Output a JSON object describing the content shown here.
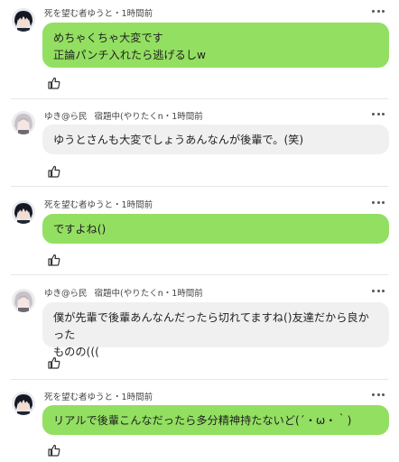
{
  "colors": {
    "own_bubble": "#93df62",
    "other_bubble": "#f0f0f0",
    "divider": "#e6e6e6"
  },
  "posts": [
    {
      "author": "死を望む者ゆうと",
      "status": "",
      "time": "1時間前",
      "text": "めちゃくちゃ大変です\n正論パンチ入れたら逃げるしw",
      "avatar_icon": "dark-hair-avatar-icon",
      "like_icon": "thumbs-up-icon",
      "more_icon": "more-options-icon"
    },
    {
      "author": "ゆき@ら民",
      "status": "宿題中(やりたくn",
      "time": "1時間前",
      "text": "ゆうとさんも大変でしょうあんなんが後輩で。(笑)",
      "avatar_icon": "light-hair-avatar-icon",
      "like_icon": "thumbs-up-icon",
      "more_icon": "more-options-icon"
    },
    {
      "author": "死を望む者ゆうと",
      "status": "",
      "time": "1時間前",
      "text": "ですよね()",
      "avatar_icon": "dark-hair-avatar-icon",
      "like_icon": "thumbs-up-icon",
      "more_icon": "more-options-icon"
    },
    {
      "author": "ゆき@ら民",
      "status": "宿題中(やりたくn",
      "time": "1時間前",
      "text": "僕が先輩で後輩あんなんだったら切れてますね()友達だから良かった\nものの(((",
      "avatar_icon": "light-hair-avatar-icon",
      "like_icon": "thumbs-up-icon",
      "more_icon": "more-options-icon"
    },
    {
      "author": "死を望む者ゆうと",
      "status": "",
      "time": "1時間前",
      "text": "リアルで後輩こんなだったら多分精神持たないど(´・ω・｀)",
      "avatar_icon": "dark-hair-avatar-icon",
      "like_icon": "thumbs-up-icon",
      "more_icon": "more-options-icon"
    }
  ]
}
